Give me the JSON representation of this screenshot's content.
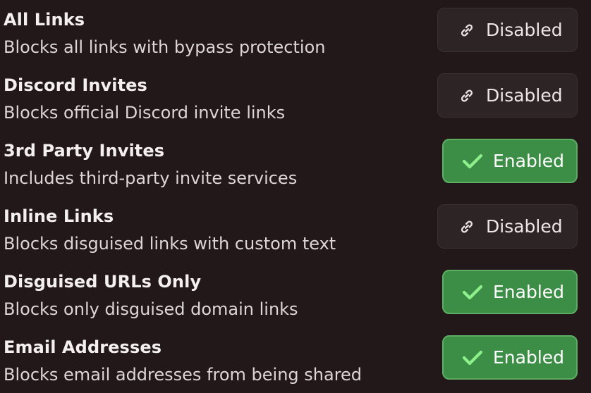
{
  "settings": [
    {
      "title": "All Links",
      "description": "Blocks all links with bypass protection",
      "state": "disabled",
      "status_label": "Disabled",
      "icon": "link-icon"
    },
    {
      "title": "Discord Invites",
      "description": "Blocks official Discord invite links",
      "state": "disabled",
      "status_label": "Disabled",
      "icon": "link-icon"
    },
    {
      "title": "3rd Party Invites",
      "description": "Includes third-party invite services",
      "state": "enabled",
      "status_label": "Enabled",
      "icon": "check-icon"
    },
    {
      "title": "Inline Links",
      "description": "Blocks disguised links with custom text",
      "state": "disabled",
      "status_label": "Disabled",
      "icon": "link-icon"
    },
    {
      "title": "Disguised URLs Only",
      "description": "Blocks only disguised domain links",
      "state": "enabled",
      "status_label": "Enabled",
      "icon": "check-icon"
    },
    {
      "title": "Email Addresses",
      "description": "Blocks email addresses from being shared",
      "state": "enabled",
      "status_label": "Enabled",
      "icon": "check-icon"
    }
  ],
  "colors": {
    "background": "#221719",
    "enabled_bg": "#3c8d46",
    "enabled_border": "#5cae63",
    "check": "#8ef08a",
    "disabled_bg": "#2d2426"
  }
}
